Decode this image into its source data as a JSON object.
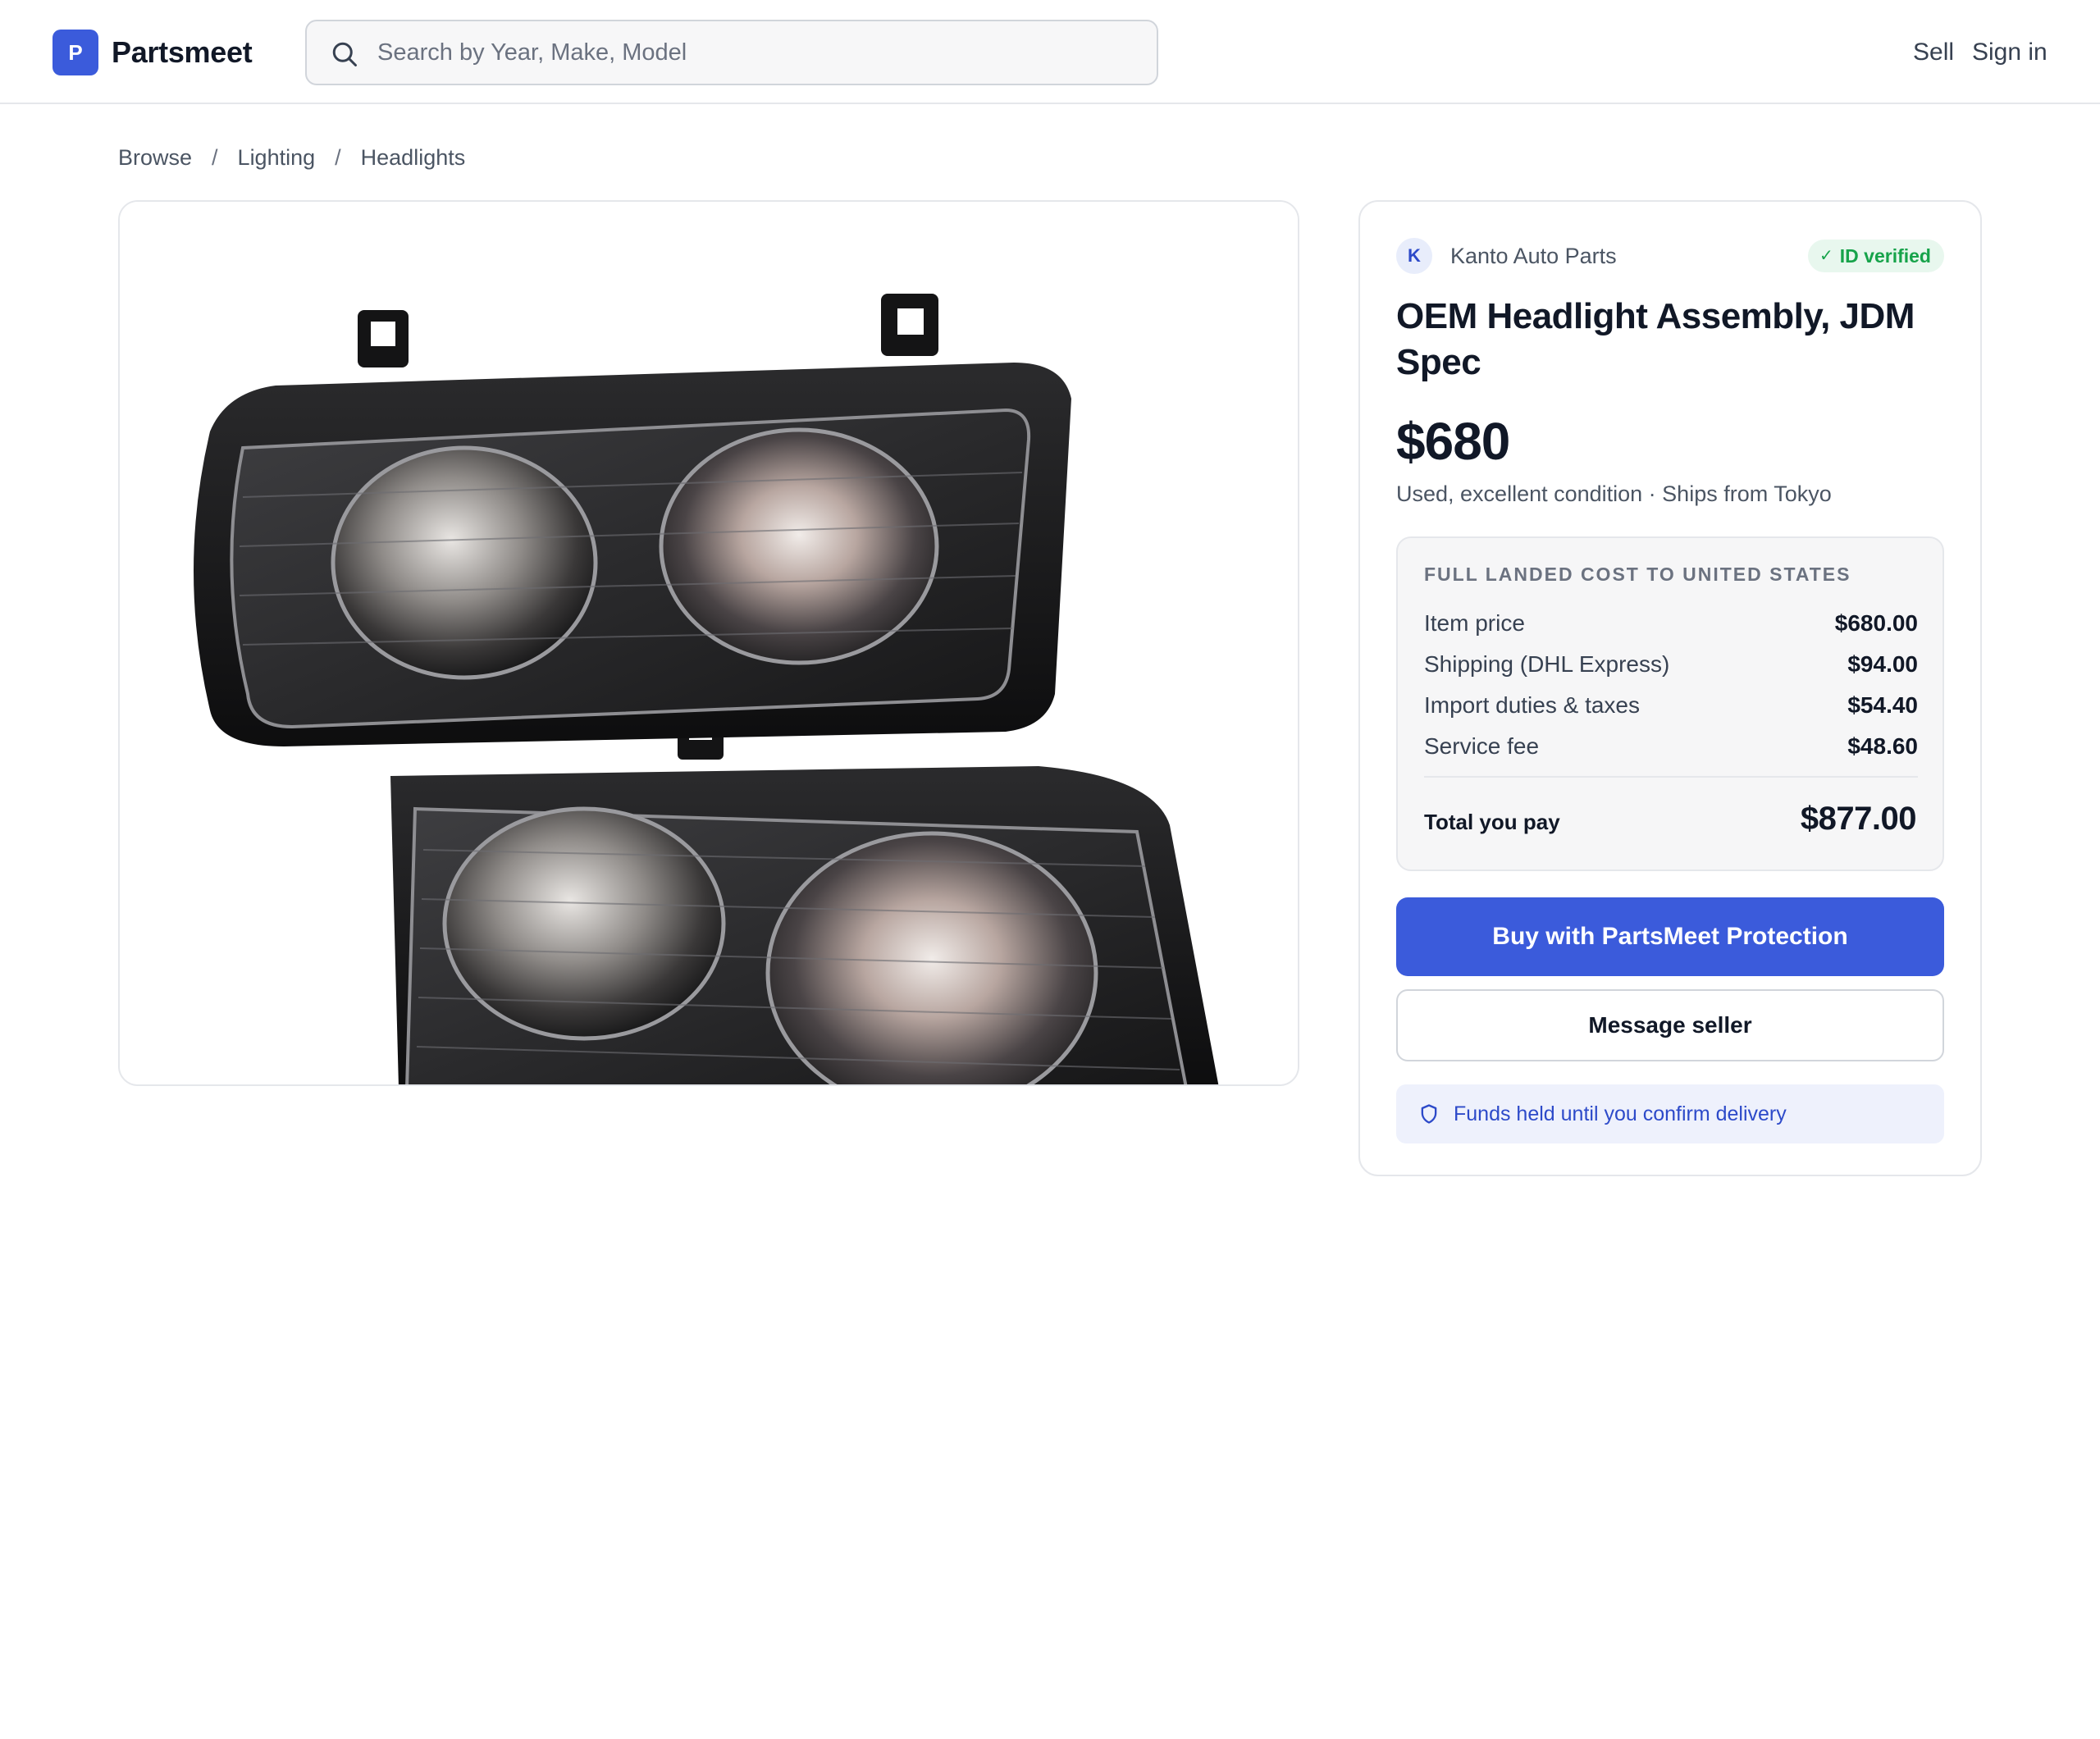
{
  "header": {
    "logo_letter": "P",
    "brand": "Partsmeet",
    "search_placeholder": "Search by Year, Make, Model",
    "nav": {
      "sell": "Sell",
      "sign_in": "Sign in"
    }
  },
  "breadcrumb": [
    "Browse",
    "Lighting",
    "Headlights"
  ],
  "product": {
    "image_alt": "Pair of black-housing headlight assemblies with twin round lenses",
    "seller": {
      "initial": "K",
      "name": "Kanto Auto Parts",
      "badge": "ID verified"
    },
    "title": "OEM Headlight Assembly, JDM Spec",
    "price": "$680",
    "condition": "Used, excellent condition · Ships from Tokyo"
  },
  "landed_cost": {
    "heading": "FULL LANDED COST TO UNITED STATES",
    "rows": [
      {
        "label": "Item price",
        "value": "$680.00"
      },
      {
        "label": "Shipping (DHL Express)",
        "value": "$94.00"
      },
      {
        "label": "Import duties & taxes",
        "value": "$54.40"
      },
      {
        "label": "Service fee",
        "value": "$48.60"
      }
    ],
    "total_label": "Total you pay",
    "total_value": "$877.00"
  },
  "actions": {
    "buy": "Buy with PartsMeet Protection",
    "message": "Message seller",
    "protection_note": "Funds held until you confirm delivery"
  },
  "colors": {
    "accent": "#3b5bdb",
    "verified": "#16a34a",
    "note_bg": "#eef1fc"
  }
}
